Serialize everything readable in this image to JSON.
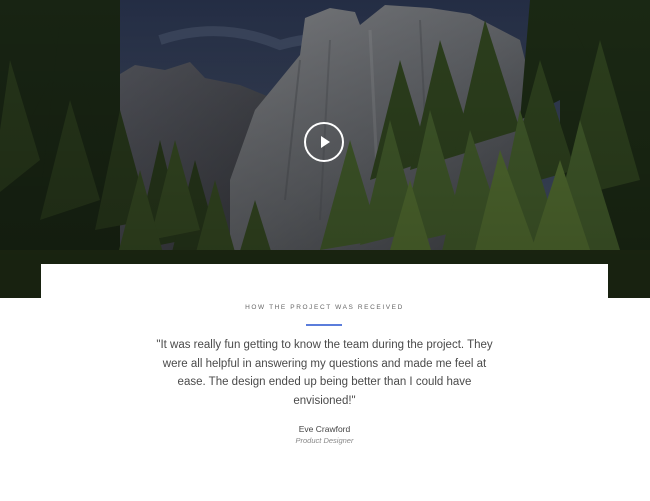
{
  "hero": {
    "play_button_icon": "play-icon"
  },
  "testimonial": {
    "eyebrow": "HOW THE PROJECT WAS RECEIVED",
    "quote": "\"It was really fun getting to know the team during the project. They were all helpful in answering my questions and made me feel at ease. The design ended up being better than I could have envisioned!\"",
    "author_name": "Eve Crawford",
    "author_role": "Product Designer"
  },
  "colors": {
    "accent": "#5b7ddb",
    "text": "#4a4a4a",
    "muted": "#888888"
  }
}
